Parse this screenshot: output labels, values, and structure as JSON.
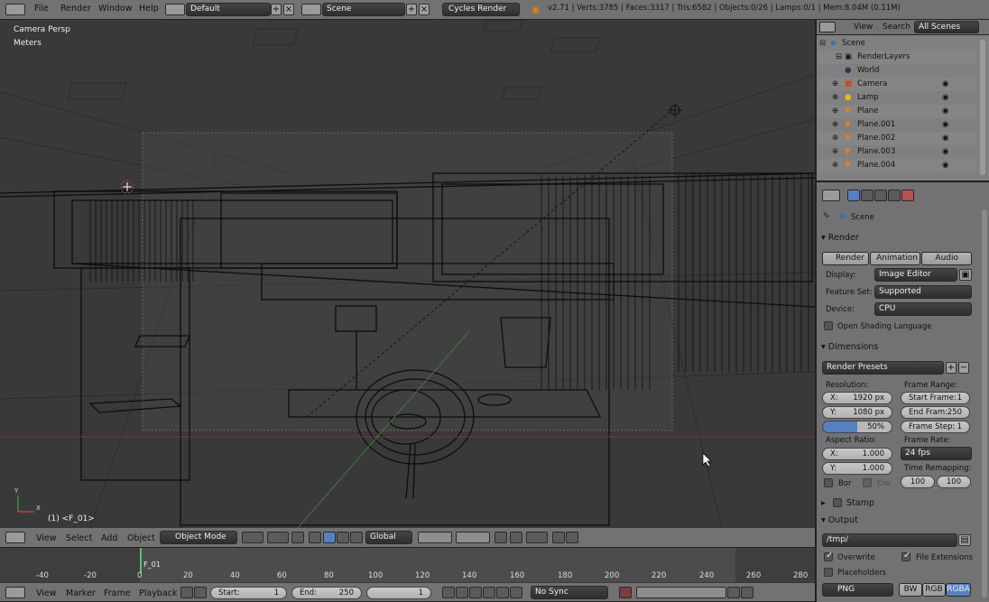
{
  "topbar": {
    "menus": [
      "File",
      "Render",
      "Window",
      "Help"
    ],
    "screen_layout": "Default",
    "scene": "Scene",
    "engine": "Cycles Render",
    "stats": "v2.71 | Verts:3785 | Faces:3317 | Tris:6582 | Objects:0/26 | Lamps:0/1 | Mem:8.04M (0.11M)"
  },
  "viewport": {
    "view_label": "Camera Persp",
    "units_label": "Meters",
    "frame_label": "(1) <F_01>",
    "axis_x": "X",
    "axis_y": "Y",
    "menus": [
      "View",
      "Select",
      "Add",
      "Object"
    ],
    "mode": "Object Mode",
    "orientation": "Global"
  },
  "outliner": {
    "tabs": [
      "View",
      "Search",
      "All Scenes"
    ],
    "items": [
      {
        "label": "Scene"
      },
      {
        "label": "RenderLayers"
      },
      {
        "label": "World"
      },
      {
        "label": "Camera"
      },
      {
        "label": "Lamp"
      },
      {
        "label": "Plane"
      },
      {
        "label": "Plane.001"
      },
      {
        "label": "Plane.002"
      },
      {
        "label": "Plane.003"
      },
      {
        "label": "Plane.004"
      }
    ]
  },
  "properties": {
    "breadcrumb": "Scene",
    "render": {
      "header": "Render",
      "buttons": [
        "Render",
        "Animation",
        "Audio"
      ],
      "display_label": "Display:",
      "display_value": "Image Editor",
      "feature_label": "Feature Set:",
      "feature_value": "Supported",
      "device_label": "Device:",
      "device_value": "CPU",
      "osl_label": "Open Shading Language"
    },
    "dimensions": {
      "header": "Dimensions",
      "presets": "Render Presets",
      "resolution_label": "Resolution:",
      "res_x_label": "X:",
      "res_x": "1920 px",
      "res_y_label": "Y:",
      "res_y": "1080 px",
      "res_pct": "50%",
      "frame_range_label": "Frame Range:",
      "start_label": "Start Frame:",
      "start": "1",
      "end_label": "End Fram:",
      "end": "250",
      "step_label": "Frame Step:",
      "step": "1",
      "aspect_label": "Aspect Ratio:",
      "asp_x_label": "X:",
      "asp_x": "1.000",
      "asp_y_label": "Y:",
      "asp_y": "1.000",
      "frame_rate_label": "Frame Rate:",
      "fps": "24 fps",
      "remap_label": "Time Remapping:",
      "remap_old": "100",
      "remap_new": "100",
      "border_label": "Bor",
      "crop_label": "Cro"
    },
    "stamp": {
      "header": "Stamp"
    },
    "output": {
      "header": "Output",
      "path": "/tmp/",
      "overwrite": "Overwrite",
      "file_ext": "File Extensions",
      "placeholders": "Placeholders",
      "format": "PNG",
      "color_modes": [
        "BW",
        "RGB",
        "RGBA"
      ]
    }
  },
  "timeline": {
    "ruler": [
      "-40",
      "-20",
      "0",
      "20",
      "40",
      "60",
      "80",
      "100",
      "120",
      "140",
      "160",
      "180",
      "200",
      "220",
      "240",
      "260",
      "280"
    ],
    "current_frame_label": "F_01",
    "menus": [
      "View",
      "Marker",
      "Frame",
      "Playback"
    ],
    "start_label": "Start:",
    "start": "1",
    "end_label": "End:",
    "end": "250",
    "current": "1",
    "sync": "No Sync"
  },
  "colors": {
    "accent_blue": "#5680c2",
    "viewport_bg": "#393939",
    "header_bg": "#727272",
    "panel_bg": "#727272"
  }
}
